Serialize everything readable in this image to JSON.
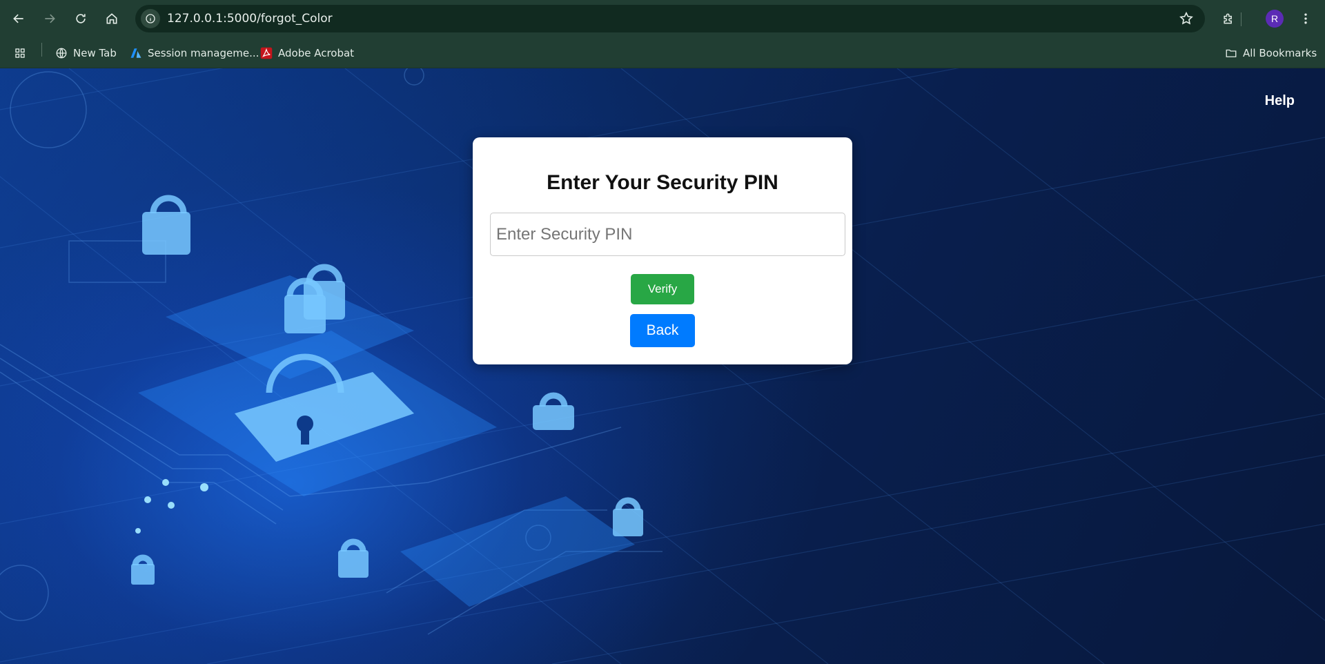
{
  "browser": {
    "url": "127.0.0.1:5000/forgot_Color",
    "profile_initial": "R",
    "bookmarks": [
      {
        "label": "New Tab",
        "icon": "globe-icon"
      },
      {
        "label": "Session manageme...",
        "icon": "azure-icon"
      },
      {
        "label": "Adobe Acrobat",
        "icon": "acrobat-icon"
      }
    ],
    "all_bookmarks_label": "All Bookmarks"
  },
  "page": {
    "help_label": "Help",
    "title": "Enter Your Security PIN",
    "pin_placeholder": "Enter Security PIN",
    "pin_value": "",
    "verify_label": "Verify",
    "back_label": "Back"
  },
  "colors": {
    "chrome_bg": "#213e33",
    "verify_button": "#28a745",
    "back_button": "#007bff",
    "profile_avatar": "#5b2bb5"
  }
}
